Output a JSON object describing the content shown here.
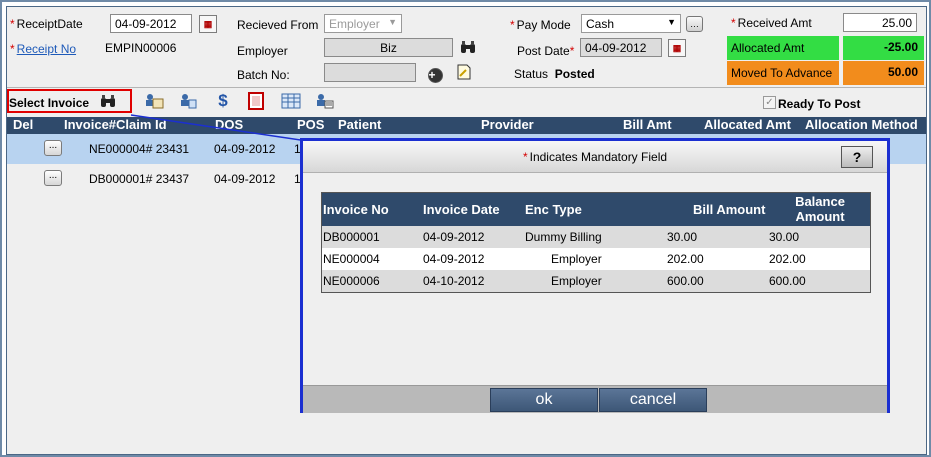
{
  "header": {
    "receipt_date_label": "ReceiptDate",
    "receipt_date": "04-09-2012",
    "receipt_no_label": "Receipt No",
    "receipt_no": "EMPIN00006",
    "received_from_label": "Recieved From",
    "received_from_value": "Employer",
    "employer_label": "Employer",
    "employer_value": "Biz",
    "batch_label": "Batch No:",
    "batch_value": "",
    "pay_mode_label": "Pay Mode",
    "pay_mode_value": "Cash",
    "post_date_label": "Post Date",
    "post_date_value": "04-09-2012",
    "status_label": "Status",
    "status_value": "Posted",
    "required_mark": "*"
  },
  "amounts": {
    "received_label": "Received Amt",
    "received_value": "25.00",
    "allocated_label": "Allocated Amt",
    "allocated_value": "-25.00",
    "advance_label": "Moved To Advance",
    "advance_value": "50.00",
    "colors": {
      "allocated": "#33dd44",
      "advance": "#f28c1c"
    }
  },
  "toolbar": {
    "select_invoice_label": "Select Invoice",
    "ready_to_post_label": "Ready To Post",
    "ready_to_post_checked": true
  },
  "grid": {
    "columns": [
      "Del",
      "Invoice#Claim Id",
      "DOS",
      "POS",
      "Patient",
      "Provider",
      "Bill Amt",
      "Allocated Amt",
      "Allocation Method"
    ],
    "rows": [
      {
        "invoice": "NE000004# 23431",
        "dos": "04-09-2012",
        "pos": "1",
        "selected": true
      },
      {
        "invoice": "DB000001# 23437",
        "dos": "04-09-2012",
        "pos": "1",
        "selected": false
      }
    ],
    "row_button": "..."
  },
  "modal": {
    "title_mark": "*",
    "title": "Indicates Mandatory Field",
    "help": "?",
    "columns": [
      "Invoice No",
      "Invoice Date",
      "Enc Type",
      "Bill Amount",
      "Balance Amount"
    ],
    "rows": [
      {
        "invoice_no": "DB000001",
        "invoice_date": "04-09-2012",
        "enc_type": "Dummy Billing",
        "bill": "30.00",
        "balance": "30.00"
      },
      {
        "invoice_no": "NE000004",
        "invoice_date": "04-09-2012",
        "enc_type": "Employer",
        "bill": "202.00",
        "balance": "202.00"
      },
      {
        "invoice_no": "NE000006",
        "invoice_date": "04-10-2012",
        "enc_type": "Employer",
        "bill": "600.00",
        "balance": "600.00"
      }
    ],
    "ok_label": "ok",
    "cancel_label": "cancel"
  }
}
